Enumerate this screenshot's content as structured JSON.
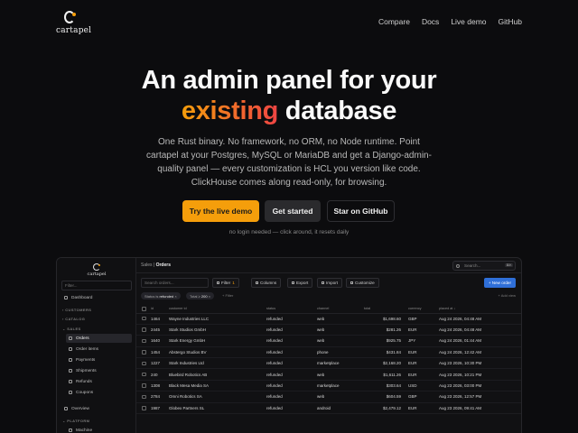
{
  "nav": {
    "brand": "cartapel",
    "links": [
      "Compare",
      "Docs",
      "Live demo",
      "GitHub"
    ]
  },
  "hero": {
    "title_line1": "An admin panel for your",
    "title_accent": "existing",
    "title_rest": " database",
    "subtitle": "One Rust binary. No framework, no ORM, no Node runtime. Point cartapel at your Postgres, MySQL or MariaDB and get a Django-admin-quality panel — every customization is HCL you version like code. ClickHouse comes along read-only, for browsing.",
    "cta_primary": "Try the live demo",
    "cta_secondary": "Get started",
    "cta_github": "Star on GitHub",
    "hint": "no login needed — click around, it resets daily"
  },
  "colors": {
    "accent": "#f59e0b",
    "accent_end": "#ef4444",
    "new_button": "#2f6fd8",
    "background": "#0c0c0e"
  },
  "app": {
    "brand": "cartapel",
    "sidebar": {
      "filter_placeholder": "Filter...",
      "dashboard": "Dashboard",
      "sections": [
        "CUSTOMERS",
        "CATALOG",
        "SALES",
        "PLATFORM"
      ],
      "items": [
        "Orders",
        "Order items",
        "Payments",
        "Shipments",
        "Refunds",
        "Coupons"
      ],
      "overview": "Overview",
      "machine": "Machine"
    },
    "breadcrumb": {
      "parent": "Sales",
      "current": "Orders"
    },
    "search": {
      "placeholder": "Search...",
      "shortcut": "⌘K"
    },
    "toolbar": {
      "search_placeholder": "Search orders...",
      "filter": "Filter",
      "filter_count": "1",
      "columns": "Columns",
      "export": "Export",
      "import": "Import",
      "customize": "Customize",
      "new_order": "+ New order"
    },
    "chips": {
      "status_label": "Status is",
      "status_value": "refunded",
      "total_label": "Total ≥",
      "total_value": "200",
      "add_filter": "+ Filter",
      "right_text": "+ Add view"
    },
    "columns": [
      "id",
      "customer id",
      "status",
      "channel",
      "total",
      "currency",
      "placed at"
    ],
    "sorted_column_suffix": " ↓",
    "rows": [
      {
        "id": "1464",
        "customer": "Wayne Industries LLC",
        "status": "refunded",
        "channel": "web",
        "total": "$1,698.60",
        "currency": "GBP",
        "placed": "Aug 24 2026, 04:48 AM"
      },
      {
        "id": "2445",
        "customer": "Stark Studios GmbH",
        "status": "refunded",
        "channel": "web",
        "total": "$281.26",
        "currency": "EUR",
        "placed": "Aug 24 2026, 04:48 AM"
      },
      {
        "id": "1640",
        "customer": "Stark Energy GmbH",
        "status": "refunded",
        "channel": "web",
        "total": "$925.75",
        "currency": "JPY",
        "placed": "Aug 24 2026, 01:44 AM"
      },
      {
        "id": "1454",
        "customer": "Abstergo Studios BV",
        "status": "refunded",
        "channel": "phone",
        "total": "$431.84",
        "currency": "EUR",
        "placed": "Aug 24 2026, 12:42 AM"
      },
      {
        "id": "1227",
        "customer": "Stark Industries Ltd",
        "status": "refunded",
        "channel": "marketplace",
        "total": "$2,168.20",
        "currency": "EUR",
        "placed": "Aug 23 2026, 10:30 PM"
      },
      {
        "id": "240",
        "customer": "Bluebird Robotics AB",
        "status": "refunded",
        "channel": "web",
        "total": "$1,611.26",
        "currency": "EUR",
        "placed": "Aug 23 2026, 10:21 PM"
      },
      {
        "id": "1308",
        "customer": "Black Mesa Media SA",
        "status": "refunded",
        "channel": "marketplace",
        "total": "$303.64",
        "currency": "USD",
        "placed": "Aug 23 2026, 03:00 PM"
      },
      {
        "id": "2784",
        "customer": "Omni Robotics SA",
        "status": "refunded",
        "channel": "web",
        "total": "$604.59",
        "currency": "GBP",
        "placed": "Aug 23 2026, 12:57 PM"
      },
      {
        "id": "1987",
        "customer": "Globex Partners SL",
        "status": "refunded",
        "channel": "android",
        "total": "$2,479.12",
        "currency": "EUR",
        "placed": "Aug 23 2026, 09:41 AM"
      }
    ]
  }
}
